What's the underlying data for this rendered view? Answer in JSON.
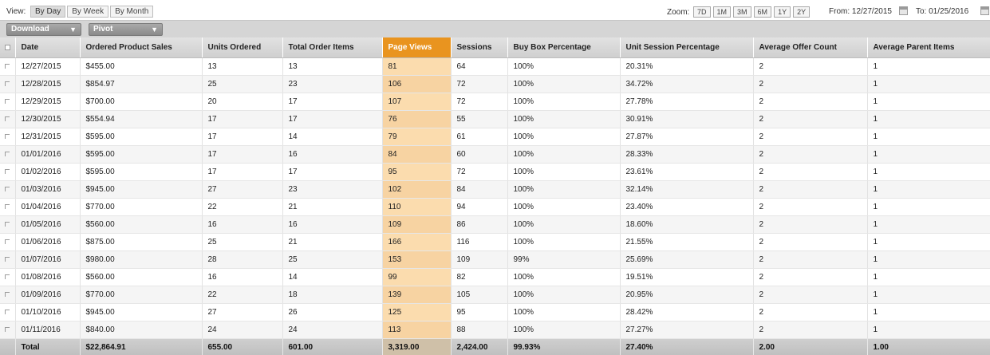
{
  "view": {
    "label": "View:",
    "options": [
      "By Day",
      "By Week",
      "By Month"
    ],
    "active": "By Day"
  },
  "zoom": {
    "label": "Zoom:",
    "options": [
      "7D",
      "1M",
      "3M",
      "6M",
      "1Y",
      "2Y"
    ]
  },
  "date_range": {
    "from": "From: 12/27/2015",
    "to": "To:  01/25/2016"
  },
  "toolbar": {
    "download_label": "Download",
    "pivot_label": "Pivot"
  },
  "table": {
    "highlighted_column": "Page Views",
    "highlight_color": "#e9941f",
    "columns": [
      "Date",
      "Ordered Product Sales",
      "Units Ordered",
      "Total Order Items",
      "Page Views",
      "Sessions",
      "Buy Box Percentage",
      "Unit Session Percentage",
      "Average Offer Count",
      "Average Parent Items"
    ],
    "rows": [
      [
        "12/27/2015",
        "$455.00",
        "13",
        "13",
        "81",
        "64",
        "100%",
        "20.31%",
        "2",
        "1"
      ],
      [
        "12/28/2015",
        "$854.97",
        "25",
        "23",
        "106",
        "72",
        "100%",
        "34.72%",
        "2",
        "1"
      ],
      [
        "12/29/2015",
        "$700.00",
        "20",
        "17",
        "107",
        "72",
        "100%",
        "27.78%",
        "2",
        "1"
      ],
      [
        "12/30/2015",
        "$554.94",
        "17",
        "17",
        "76",
        "55",
        "100%",
        "30.91%",
        "2",
        "1"
      ],
      [
        "12/31/2015",
        "$595.00",
        "17",
        "14",
        "79",
        "61",
        "100%",
        "27.87%",
        "2",
        "1"
      ],
      [
        "01/01/2016",
        "$595.00",
        "17",
        "16",
        "84",
        "60",
        "100%",
        "28.33%",
        "2",
        "1"
      ],
      [
        "01/02/2016",
        "$595.00",
        "17",
        "17",
        "95",
        "72",
        "100%",
        "23.61%",
        "2",
        "1"
      ],
      [
        "01/03/2016",
        "$945.00",
        "27",
        "23",
        "102",
        "84",
        "100%",
        "32.14%",
        "2",
        "1"
      ],
      [
        "01/04/2016",
        "$770.00",
        "22",
        "21",
        "110",
        "94",
        "100%",
        "23.40%",
        "2",
        "1"
      ],
      [
        "01/05/2016",
        "$560.00",
        "16",
        "16",
        "109",
        "86",
        "100%",
        "18.60%",
        "2",
        "1"
      ],
      [
        "01/06/2016",
        "$875.00",
        "25",
        "21",
        "166",
        "116",
        "100%",
        "21.55%",
        "2",
        "1"
      ],
      [
        "01/07/2016",
        "$980.00",
        "28",
        "25",
        "153",
        "109",
        "99%",
        "25.69%",
        "2",
        "1"
      ],
      [
        "01/08/2016",
        "$560.00",
        "16",
        "14",
        "99",
        "82",
        "100%",
        "19.51%",
        "2",
        "1"
      ],
      [
        "01/09/2016",
        "$770.00",
        "22",
        "18",
        "139",
        "105",
        "100%",
        "20.95%",
        "2",
        "1"
      ],
      [
        "01/10/2016",
        "$945.00",
        "27",
        "26",
        "125",
        "95",
        "100%",
        "28.42%",
        "2",
        "1"
      ],
      [
        "01/11/2016",
        "$840.00",
        "24",
        "24",
        "113",
        "88",
        "100%",
        "27.27%",
        "2",
        "1"
      ]
    ],
    "total": [
      "Total",
      "$22,864.91",
      "655.00",
      "601.00",
      "3,319.00",
      "2,424.00",
      "99.93%",
      "27.40%",
      "2.00",
      "1.00"
    ]
  }
}
